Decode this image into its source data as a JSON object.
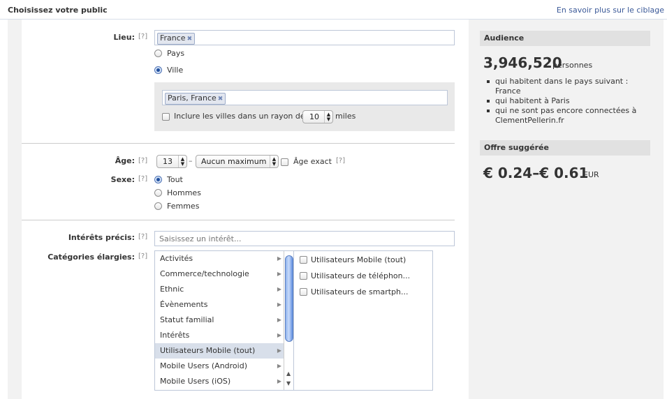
{
  "header": {
    "title": "Choisissez votre public",
    "link": "En savoir plus sur le ciblage"
  },
  "help": "[?]",
  "location": {
    "label": "Lieu:",
    "country_token": "France",
    "options": {
      "country": "Pays",
      "city": "Ville"
    },
    "selected": "Ville",
    "city_token": "Paris, France",
    "radius_label": "Inclure les villes dans un rayon de",
    "radius_value": "10",
    "radius_unit": "miles"
  },
  "age": {
    "label": "Âge:",
    "min": "13",
    "dash": "–",
    "max": "Aucun maximum",
    "exact_label": "Âge exact"
  },
  "sex": {
    "label": "Sexe:",
    "options": [
      "Tout",
      "Hommes",
      "Femmes"
    ],
    "selected": "Tout"
  },
  "interests": {
    "label": "Intérêts précis:",
    "placeholder": "Saisissez un intérêt..."
  },
  "categories": {
    "label": "Catégories élargies:",
    "items": [
      "Activités",
      "Commerce/technologie",
      "Ethnic",
      "Évènements",
      "Statut familial",
      "Intérêts",
      "Utilisateurs Mobile (tout)",
      "Mobile Users (Android)",
      "Mobile Users (iOS)"
    ],
    "selected": "Utilisateurs Mobile (tout)",
    "subitems": [
      "Utilisateurs Mobile (tout)",
      "Utilisateurs de téléphon...",
      "Utilisateurs de smartph..."
    ]
  },
  "audience": {
    "title": "Audience",
    "count": "3,946,520",
    "unit": "personnes",
    "criteria": [
      "qui habitent dans le pays suivant : France",
      "qui habitent à Paris",
      "qui ne sont pas encore connectées à ClementPellerin.fr"
    ]
  },
  "bid": {
    "title": "Offre suggérée",
    "range": "€ 0.24–€ 0.61",
    "currency": "EUR"
  }
}
